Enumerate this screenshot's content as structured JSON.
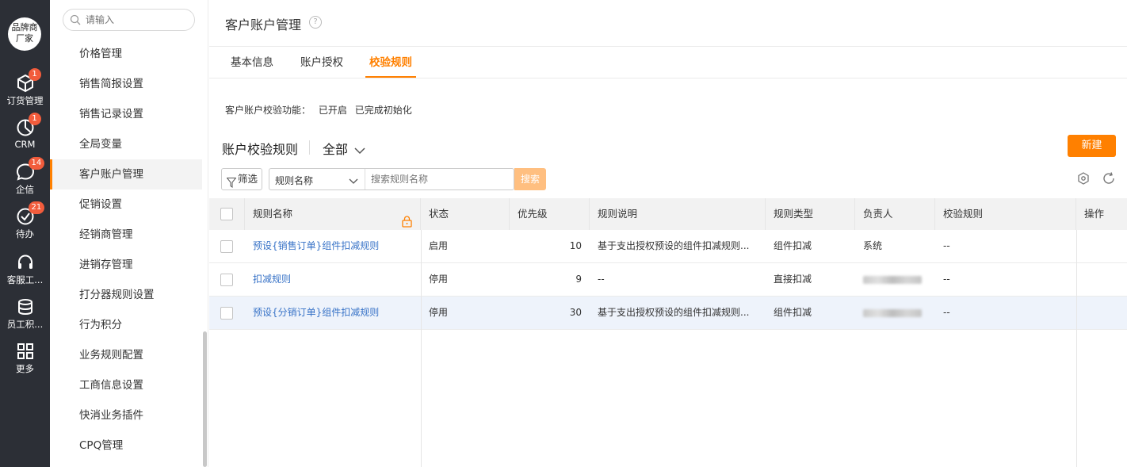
{
  "rail": {
    "brand": "品牌商厂家",
    "items": [
      {
        "label": "订货管理",
        "icon": "box-icon",
        "badge": "1"
      },
      {
        "label": "CRM",
        "icon": "pie-chart-icon",
        "badge": "1"
      },
      {
        "label": "企信",
        "icon": "chat-icon",
        "badge": "14"
      },
      {
        "label": "待办",
        "icon": "check-circle-icon",
        "badge": "21"
      },
      {
        "label": "客服工...",
        "icon": "headset-icon",
        "badge": ""
      },
      {
        "label": "员工积...",
        "icon": "database-icon",
        "badge": ""
      },
      {
        "label": "更多",
        "icon": "grid-icon",
        "badge": ""
      }
    ]
  },
  "sidebar": {
    "search_placeholder": "请输入",
    "items": [
      {
        "label": "价格管理"
      },
      {
        "label": "销售简报设置"
      },
      {
        "label": "销售记录设置"
      },
      {
        "label": "全局变量"
      },
      {
        "label": "客户账户管理",
        "active": true
      },
      {
        "label": "促销设置"
      },
      {
        "label": "经销商管理"
      },
      {
        "label": "进销存管理"
      },
      {
        "label": "打分器规则设置"
      },
      {
        "label": "行为积分"
      },
      {
        "label": "业务规则配置"
      },
      {
        "label": "工商信息设置"
      },
      {
        "label": "快消业务插件"
      },
      {
        "label": "CPQ管理"
      }
    ]
  },
  "header": {
    "title": "客户账户管理",
    "help": "?",
    "tabs": [
      {
        "label": "基本信息"
      },
      {
        "label": "账户授权"
      },
      {
        "label": "校验规则",
        "active": true
      }
    ]
  },
  "status": {
    "label": "客户账户校验功能：",
    "enabled": "已开启",
    "initialized": "已完成初始化"
  },
  "section": {
    "title": "账户校验规则",
    "filter_value": "全部",
    "new_button": "新建"
  },
  "toolbar": {
    "filter_button": "筛选",
    "field_select": "规则名称",
    "search_placeholder": "搜索规则名称",
    "search_button": "搜索"
  },
  "table": {
    "columns": [
      "规则名称",
      "状态",
      "优先级",
      "规则说明",
      "规则类型",
      "负责人",
      "校验规则",
      "操作"
    ],
    "rows": [
      {
        "name": "预设{销售订单}组件扣减规则",
        "status": "启用",
        "priority": "10",
        "desc": "基于支出授权预设的组件扣减规则...",
        "type": "组件扣减",
        "owner": "系统",
        "rule": "--"
      },
      {
        "name": "扣减规则",
        "status": "停用",
        "priority": "9",
        "desc": "--",
        "type": "直接扣减",
        "owner": "",
        "rule": "--"
      },
      {
        "name": "预设{分销订单}组件扣减规则",
        "status": "停用",
        "priority": "30",
        "desc": "基于支出授权预设的组件扣减规则...",
        "type": "组件扣减",
        "owner": "",
        "rule": "--"
      }
    ]
  },
  "colors": {
    "accent": "#ff8000",
    "link": "#3873c7",
    "rail_bg": "#2c2f36",
    "badge": "#f25c3c"
  }
}
